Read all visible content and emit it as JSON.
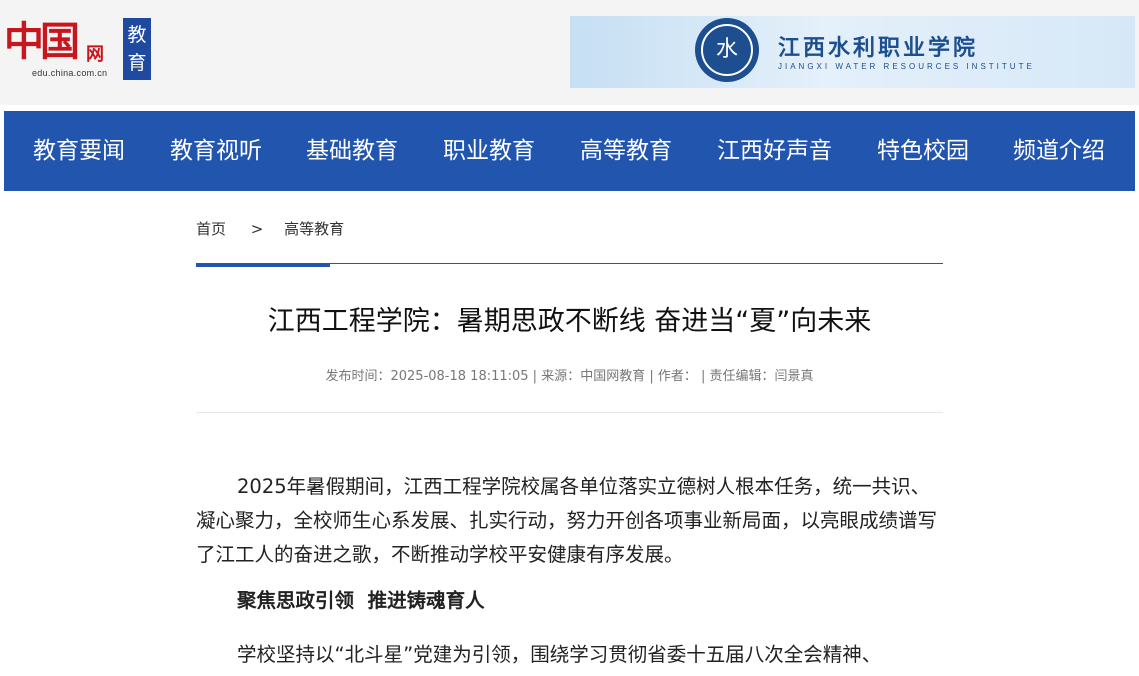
{
  "header": {
    "logo": {
      "main": "中国",
      "suffix": "网",
      "domain": "edu.china.com.cn",
      "channel": "教育"
    },
    "banner": {
      "seal": "水",
      "name_cn": "江西水利职业学院",
      "name_en": "JIANGXI WATER RESOURCES INSTITUTE"
    }
  },
  "nav": {
    "items": [
      "教育要闻",
      "教育视听",
      "基础教育",
      "职业教育",
      "高等教育",
      "江西好声音",
      "特色校园",
      "频道介绍"
    ]
  },
  "breadcrumb": {
    "home": "首页",
    "separator": ">",
    "current": "高等教育"
  },
  "article": {
    "title": "江西工程学院：暑期思政不断线 奋进当“夏”向未来",
    "meta": "发布时间：2025-08-18 18:11:05 | 来源：中国网教育 | 作者： | 责任编辑：闫景真",
    "para1": "2025年暑假期间，江西工程学院校属各单位落实立德树人根本任务，统一共识、凝心聚力，全校师生心系发展、扎实行动，努力开创各项事业新局面，以亮眼成绩谱写了江工人的奋进之歌，不断推动学校平安健康有序发展。",
    "heading1": "聚焦思政引领  推进铸魂育人",
    "para2": "学校坚持以“北斗星”党建为引领，围绕学习贯彻省委十五届八次全会精神、"
  },
  "colors": {
    "brand_blue": "#2255ad",
    "logo_red": "#c8161d"
  }
}
